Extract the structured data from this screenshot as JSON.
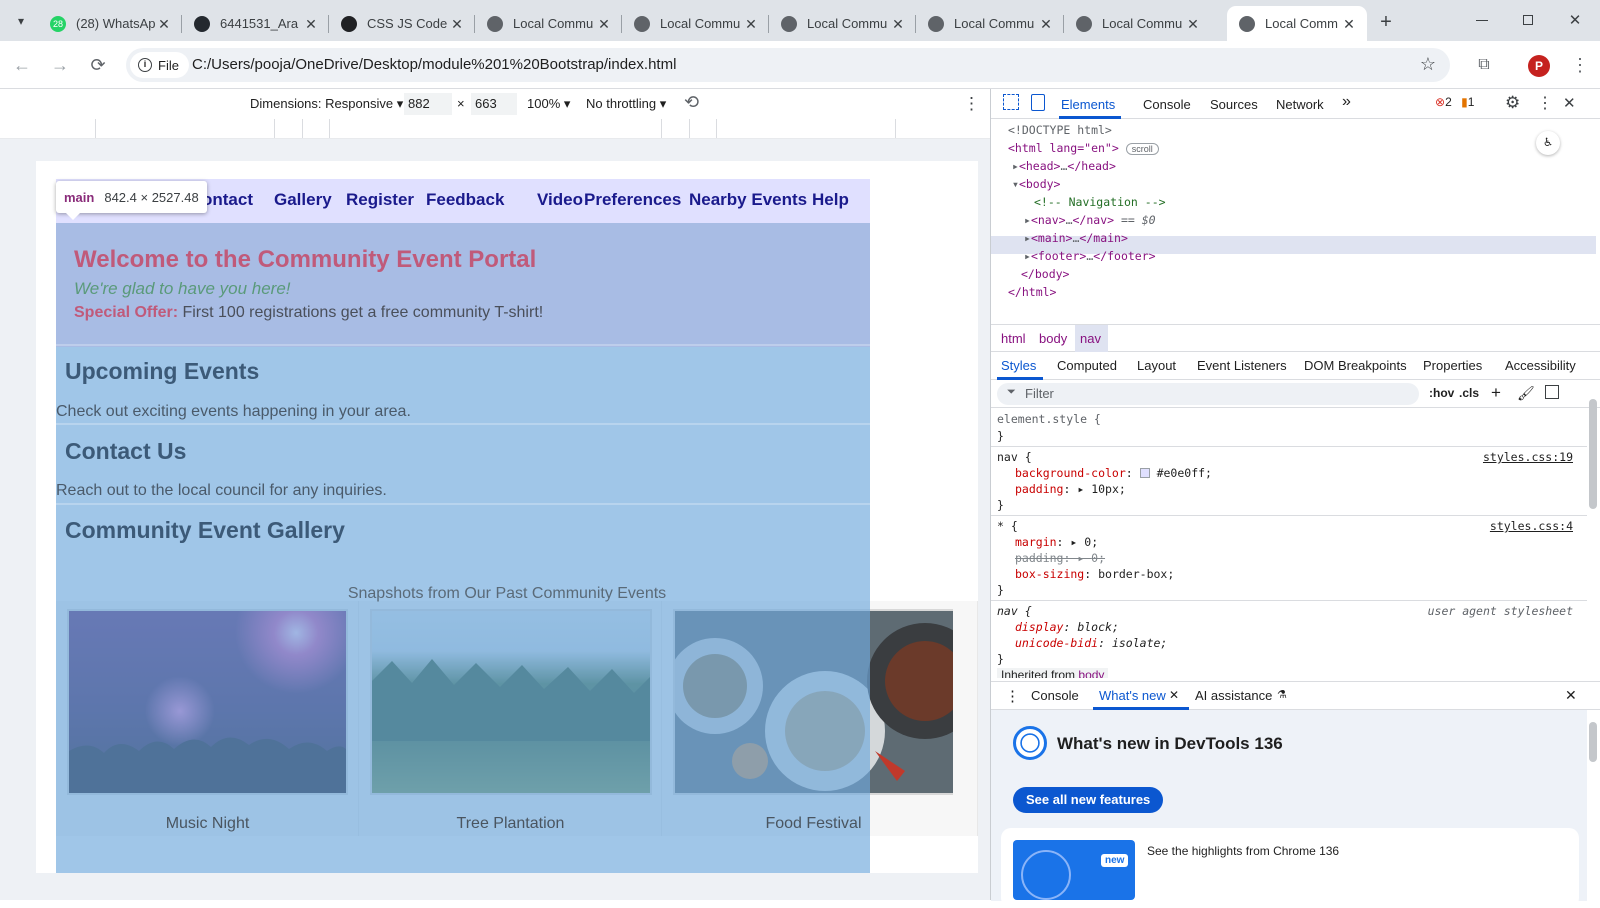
{
  "browser": {
    "tabs": [
      {
        "title": "(28) WhatsApp",
        "badge": "28"
      },
      {
        "title": "6441531_Ara"
      },
      {
        "title": "CSS JS Code"
      },
      {
        "title": "Local Commu"
      },
      {
        "title": "Local Commu"
      },
      {
        "title": "Local Commu"
      },
      {
        "title": "Local Commu"
      },
      {
        "title": "Local Commu"
      },
      {
        "title": "Local Comm"
      }
    ],
    "new_tab": "+",
    "file_chip": "File",
    "url": "C:/Users/pooja/OneDrive/Desktop/module%201%20Bootstrap/index.html",
    "profile_initial": "P"
  },
  "device_toolbar": {
    "dimensions_label": "Dimensions: Responsive",
    "width": "882",
    "height": "663",
    "times": "×",
    "zoom": "100%",
    "throttling": "No throttling"
  },
  "page": {
    "nav_links": [
      "ontact",
      "Gallery",
      "Register",
      "Feedback",
      "Video",
      "Preferences",
      "Nearby Events",
      "Help"
    ],
    "welcome_title": "Welcome to the Community Event Portal",
    "tagline": "We're glad to have you here!",
    "offer_label": "Special Offer:",
    "offer_text": " First 100 registrations get a free community T-shirt!",
    "sections": [
      {
        "title": "Upcoming Events",
        "text": "Check out exciting events happening in your area."
      },
      {
        "title": "Contact Us",
        "text": "Reach out to the local council for any inquiries."
      },
      {
        "title": "Community Event Gallery"
      }
    ],
    "gallery_subtitle": "Snapshots from Our Past Community Events",
    "gallery": [
      {
        "caption": "Music Night"
      },
      {
        "caption": "Tree Plantation"
      },
      {
        "caption": "Food Festival"
      }
    ],
    "tooltip": {
      "tag": "main",
      "size": "842.4 × 2527.48"
    }
  },
  "devtools": {
    "tabs": [
      "Elements",
      "Console",
      "Sources",
      "Network"
    ],
    "error_count": "2",
    "warning_count": "1",
    "dom": {
      "doctype": "<!DOCTYPE html>",
      "html_open": "<html lang=\"en\">",
      "scroll_badge": "scroll",
      "head": "<head>",
      "head_close": "</head>",
      "body_open": "<body>",
      "comment": "<!-- Navigation -->",
      "nav": "<nav>",
      "nav_close": "</nav>",
      "selected_marker": "== $0",
      "main": "<main>",
      "main_close": "</main>",
      "footer": "<footer>",
      "footer_close": "</footer>",
      "body_close": "</body>",
      "html_close": "</html>",
      "ellipsis": "…"
    },
    "breadcrumbs": [
      "html",
      "body",
      "nav"
    ],
    "subtabs": [
      "Styles",
      "Computed",
      "Layout",
      "Event Listeners",
      "DOM Breakpoints",
      "Properties",
      "Accessibility"
    ],
    "filter_placeholder": "Filter",
    "hov": ":hov",
    "cls": ".cls",
    "styles": {
      "element_style": "element.style {",
      "close": "}",
      "nav_selector": "nav {",
      "nav_source": "styles.css:19",
      "bg_prop": "background-color",
      "bg_val": "#e0e0ff;",
      "bg_swatch": "#e0e0ff",
      "pad_prop": "padding",
      "pad_val": "10px;",
      "star_selector": "* {",
      "star_source": "styles.css:4",
      "margin_prop": "margin",
      "margin_val": "0;",
      "padding_struck_prop": "padding",
      "padding_struck_val": "0;",
      "boxsizing_prop": "box-sizing",
      "boxsizing_val": "border-box;",
      "ua_selector": "nav {",
      "ua_source": "user agent stylesheet",
      "display_prop": "display",
      "display_val": "block;",
      "unicode_prop": "unicode-bidi",
      "unicode_val": "isolate;",
      "inherited_label": "Inherited from",
      "inherited_tag": "body"
    },
    "drawer": {
      "tabs": [
        "Console",
        "What's new",
        "AI assistance"
      ],
      "heading": "What's new in DevTools 136",
      "button": "See all new features",
      "new_badge": "new",
      "highlights": "See the highlights from Chrome 136"
    }
  },
  "colors": {
    "nav_bg": "#e0e0ff",
    "accent": "#0b57d0",
    "overlay": "#6fa8dc",
    "welcome_title": "#c05a7a",
    "profile": "#c5221f"
  }
}
